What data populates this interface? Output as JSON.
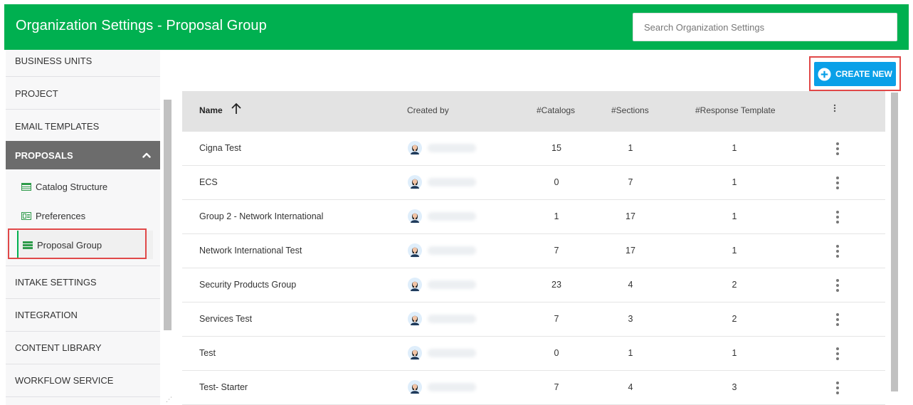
{
  "header": {
    "title": "Organization Settings - Proposal Group",
    "search_placeholder": "Search Organization Settings",
    "background_color": "#00b050"
  },
  "sidebar": {
    "items_top": [
      "BUSINESS UNITS",
      "PROJECT",
      "EMAIL TEMPLATES"
    ],
    "active_section": "PROPOSALS",
    "sub_items": [
      {
        "label": "Catalog Structure",
        "icon": "table-icon"
      },
      {
        "label": "Preferences",
        "icon": "preferences-icon"
      },
      {
        "label": "Proposal Group",
        "icon": "list-icon",
        "selected": true
      }
    ],
    "items_bottom": [
      "INTAKE SETTINGS",
      "INTEGRATION",
      "CONTENT LIBRARY",
      "WORKFLOW SERVICE"
    ]
  },
  "toolbar": {
    "create_label": "CREATE NEW",
    "create_icon": "plus-circle-icon",
    "accent_color": "#0aa0e8"
  },
  "table": {
    "columns": [
      "Name",
      "Created by",
      "#Catalogs",
      "#Sections",
      "#Response Template"
    ],
    "sort_column": "Name",
    "sort_direction": "ascending",
    "rows": [
      {
        "name": "Cigna Test",
        "catalogs": "15",
        "sections": "1",
        "templates": "1"
      },
      {
        "name": "ECS",
        "catalogs": "0",
        "sections": "7",
        "templates": "1"
      },
      {
        "name": "Group 2 - Network International",
        "catalogs": "1",
        "sections": "17",
        "templates": "1"
      },
      {
        "name": "Network International Test",
        "catalogs": "7",
        "sections": "17",
        "templates": "1"
      },
      {
        "name": "Security Products Group",
        "catalogs": "23",
        "sections": "4",
        "templates": "2"
      },
      {
        "name": "Services Test",
        "catalogs": "7",
        "sections": "3",
        "templates": "2"
      },
      {
        "name": "Test",
        "catalogs": "0",
        "sections": "1",
        "templates": "1"
      },
      {
        "name": "Test- Starter",
        "catalogs": "7",
        "sections": "4",
        "templates": "3"
      }
    ]
  }
}
